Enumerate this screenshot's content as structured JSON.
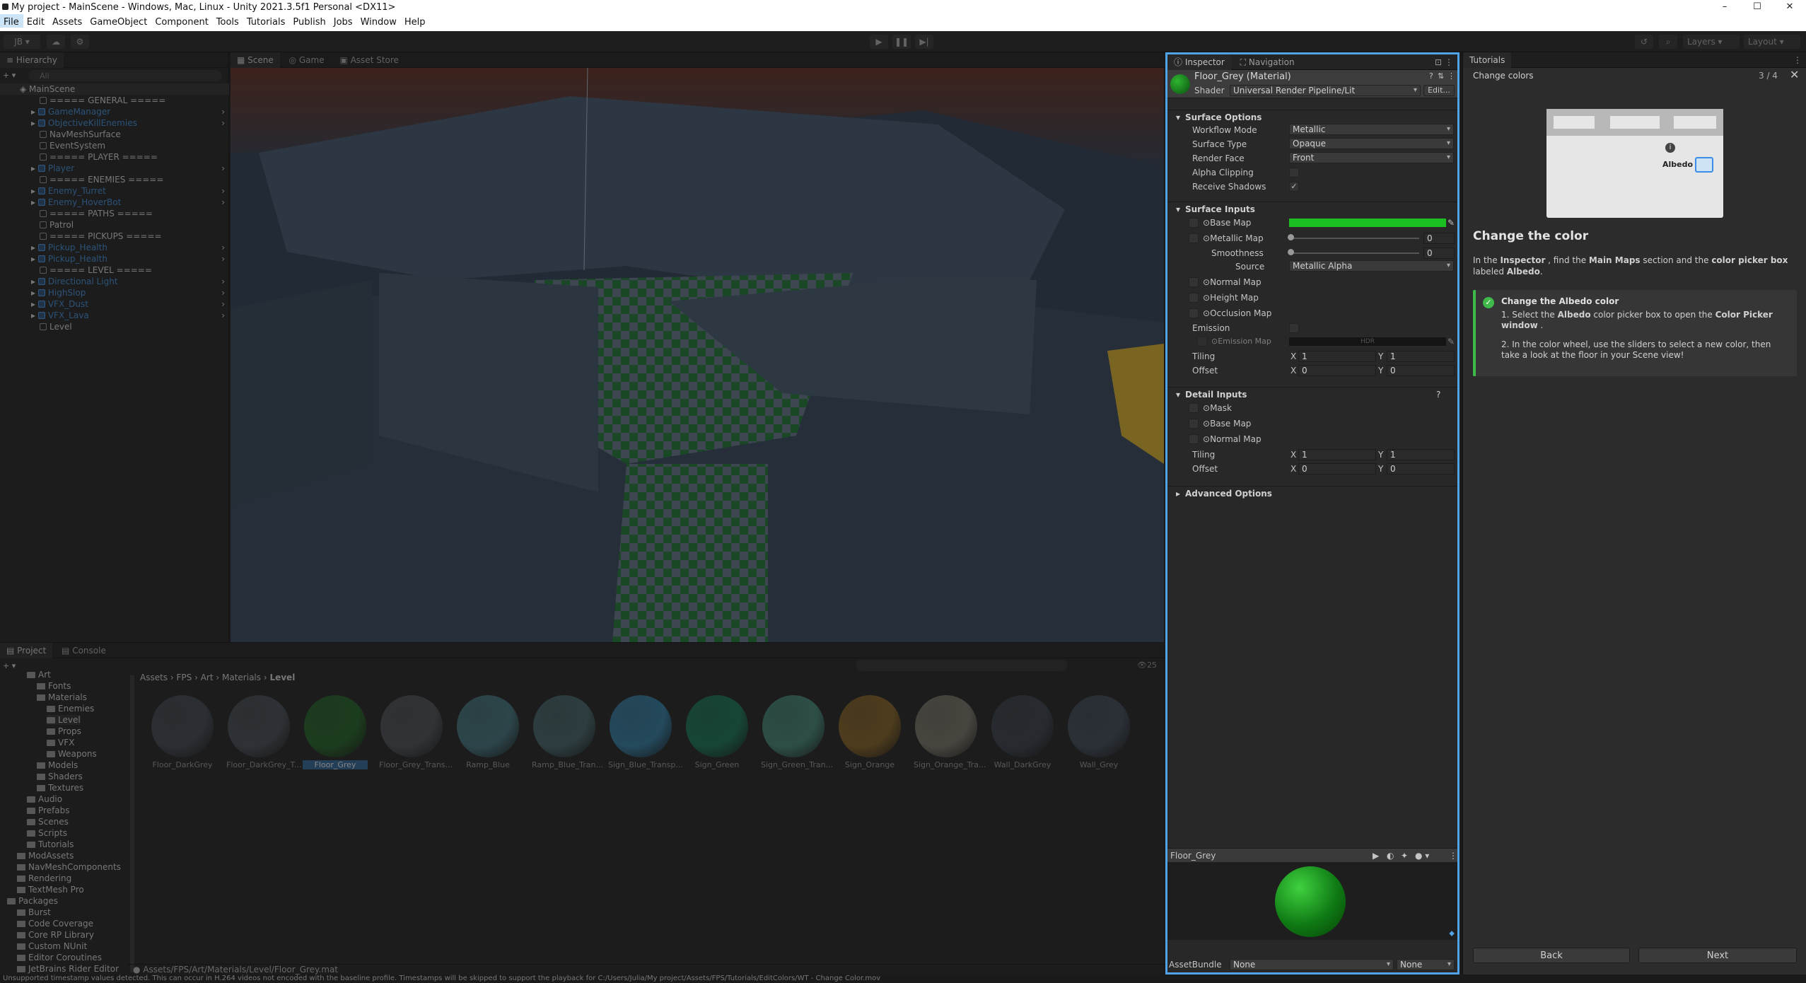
{
  "window": {
    "title": "My project - MainScene - Windows, Mac, Linux - Unity 2021.3.5f1 Personal <DX11>",
    "controls": [
      "minimize",
      "maximize",
      "close"
    ]
  },
  "menu": [
    "File",
    "Edit",
    "Assets",
    "GameObject",
    "Component",
    "Tools",
    "Tutorials",
    "Publish",
    "Jobs",
    "Window",
    "Help"
  ],
  "toolbar": {
    "account": "JB",
    "right_dropdowns": [
      "Layers",
      "Layout"
    ]
  },
  "hierarchy": {
    "tab": "Hierarchy",
    "search_placeholder": "All",
    "scene": "MainScene",
    "items": [
      {
        "label": "===== GENERAL =====",
        "prefab": false
      },
      {
        "label": "GameManager",
        "prefab": true
      },
      {
        "label": "ObjectiveKillEnemies",
        "prefab": true
      },
      {
        "label": "NavMeshSurface",
        "prefab": false
      },
      {
        "label": "EventSystem",
        "prefab": false
      },
      {
        "label": "===== PLAYER =====",
        "prefab": false
      },
      {
        "label": "Player",
        "prefab": true
      },
      {
        "label": "===== ENEMIES =====",
        "prefab": false
      },
      {
        "label": "Enemy_Turret",
        "prefab": true
      },
      {
        "label": "Enemy_HoverBot",
        "prefab": true
      },
      {
        "label": "===== PATHS =====",
        "prefab": false
      },
      {
        "label": "Patrol",
        "prefab": false
      },
      {
        "label": "===== PICKUPS =====",
        "prefab": false
      },
      {
        "label": "Pickup_Health",
        "prefab": true
      },
      {
        "label": "Pickup_Health",
        "prefab": true
      },
      {
        "label": "===== LEVEL =====",
        "prefab": false
      },
      {
        "label": "Directional Light",
        "prefab": true
      },
      {
        "label": "HighSlop",
        "prefab": true
      },
      {
        "label": "VFX_Dust",
        "prefab": true
      },
      {
        "label": "VFX_Lava",
        "prefab": true
      },
      {
        "label": "Level",
        "prefab": false
      }
    ]
  },
  "scene_tabs": [
    "Scene",
    "Game",
    "Asset Store"
  ],
  "project": {
    "tabs": [
      "Project",
      "Console"
    ],
    "tree": [
      {
        "label": "Art",
        "indent": 2
      },
      {
        "label": "Fonts",
        "indent": 3
      },
      {
        "label": "Materials",
        "indent": 3
      },
      {
        "label": "Enemies",
        "indent": 4
      },
      {
        "label": "Level",
        "indent": 4
      },
      {
        "label": "Props",
        "indent": 4
      },
      {
        "label": "VFX",
        "indent": 4
      },
      {
        "label": "Weapons",
        "indent": 4
      },
      {
        "label": "Models",
        "indent": 3
      },
      {
        "label": "Shaders",
        "indent": 3
      },
      {
        "label": "Textures",
        "indent": 3
      },
      {
        "label": "Audio",
        "indent": 2
      },
      {
        "label": "Prefabs",
        "indent": 2
      },
      {
        "label": "Scenes",
        "indent": 2
      },
      {
        "label": "Scripts",
        "indent": 2
      },
      {
        "label": "Tutorials",
        "indent": 2
      },
      {
        "label": "ModAssets",
        "indent": 1
      },
      {
        "label": "NavMeshComponents",
        "indent": 1
      },
      {
        "label": "Rendering",
        "indent": 1
      },
      {
        "label": "TextMesh Pro",
        "indent": 1
      },
      {
        "label": "Packages",
        "indent": 0
      },
      {
        "label": "Burst",
        "indent": 1
      },
      {
        "label": "Code Coverage",
        "indent": 1
      },
      {
        "label": "Core RP Library",
        "indent": 1
      },
      {
        "label": "Custom NUnit",
        "indent": 1
      },
      {
        "label": "Editor Coroutines",
        "indent": 1
      },
      {
        "label": "JetBrains Rider Editor",
        "indent": 1
      }
    ],
    "breadcrumb": [
      "Assets",
      "FPS",
      "Art",
      "Materials",
      "Level"
    ],
    "count": "25",
    "materials": [
      {
        "name": "Floor_DarkGrey",
        "color": "#3b4148"
      },
      {
        "name": "Floor_DarkGrey_T...",
        "color": "#40464d"
      },
      {
        "name": "Floor_Grey",
        "color": "#1f5a24"
      },
      {
        "name": "Floor_Grey_Trans...",
        "color": "#45494e"
      },
      {
        "name": "Ramp_Blue",
        "color": "#3d6a72"
      },
      {
        "name": "Ramp_Blue_Tran...",
        "color": "#3f5b60"
      },
      {
        "name": "Sign_Blue_Transp...",
        "color": "#2e7294"
      },
      {
        "name": "Sign_Green",
        "color": "#176b4e"
      },
      {
        "name": "Sign_Green_Tran...",
        "color": "#3f7a6e"
      },
      {
        "name": "Sign_Orange",
        "color": "#7a5a22"
      },
      {
        "name": "Sign_Orange_Tra...",
        "color": "#6e6a5e"
      },
      {
        "name": "Wall_DarkGrey",
        "color": "#343b43"
      },
      {
        "name": "Wall_Grey",
        "color": "#3a4450"
      }
    ],
    "path": "Assets/FPS/Art/Materials/Level/Floor_Grey.mat"
  },
  "inspector": {
    "tabs": [
      "Inspector",
      "Navigation"
    ],
    "title": "Floor_Grey (Material)",
    "shader_label": "Shader",
    "shader_value": "Universal Render Pipeline/Lit",
    "edit_button": "Edit...",
    "surface_options": {
      "header": "Surface Options",
      "rows": [
        {
          "label": "Workflow Mode",
          "value": "Metallic"
        },
        {
          "label": "Surface Type",
          "value": "Opaque"
        },
        {
          "label": "Render Face",
          "value": "Front"
        }
      ],
      "alpha_clipping": "Alpha Clipping",
      "alpha_clipping_checked": false,
      "receive_shadows": "Receive Shadows",
      "receive_shadows_checked": true
    },
    "surface_inputs": {
      "header": "Surface Inputs",
      "base_map": "Base Map",
      "base_color": "#1bbf22",
      "metallic_map": "Metallic Map",
      "metallic_value": "0",
      "smoothness": "Smoothness",
      "smoothness_value": "0",
      "source": "Source",
      "source_value": "Metallic Alpha",
      "normal_map": "Normal Map",
      "height_map": "Height Map",
      "occlusion_map": "Occlusion Map",
      "emission": "Emission",
      "emission_map": "Emission Map",
      "hdr": "HDR",
      "tiling": "Tiling",
      "tiling_x": "1",
      "tiling_y": "1",
      "offset": "Offset",
      "offset_x": "0",
      "offset_y": "0"
    },
    "detail_inputs": {
      "header": "Detail Inputs",
      "mask": "Mask",
      "base_map": "Base Map",
      "normal_map": "Normal Map",
      "tiling": "Tiling",
      "tiling_x": "1",
      "tiling_y": "1",
      "offset": "Offset",
      "offset_x": "0",
      "offset_y": "0"
    },
    "advanced": "Advanced Options",
    "preview_name": "Floor_Grey",
    "asset_bundle": "AssetBundle",
    "asset_bundle_value": "None",
    "asset_bundle_variant": "None",
    "axis_x": "X",
    "axis_y": "Y"
  },
  "tutorial": {
    "tab": "Tutorials",
    "lesson": "Change colors",
    "progress": "3 / 4",
    "thumb_label": "Albedo",
    "heading": "Change the color",
    "intro": {
      "p1": "In the ",
      "b1": "Inspector",
      "p2": " , find the ",
      "b2": "Main Maps",
      "p3": " section and the ",
      "b3": "color picker box",
      "p4": " labeled ",
      "b4": "Albedo",
      "p5": "."
    },
    "task": {
      "title": "Change the Albedo color",
      "s1a": "1. Select the ",
      "s1b": "Albedo",
      "s1c": " color picker box to open the ",
      "s1d": "Color Picker window",
      "s1e": " .",
      "s2": "2. In the color wheel, use the sliders to select a new color, then take a look at the floor in your Scene view!"
    },
    "back": "Back",
    "next": "Next"
  },
  "status": "Unsupported timestamp values detected. This can occur in H.264 videos not encoded with the baseline profile. Timestamps will be skipped to support the playback for C:/Users/Julia/My project/Assets/FPS/Tutorials/EditColors/WT - Change Color.mov"
}
